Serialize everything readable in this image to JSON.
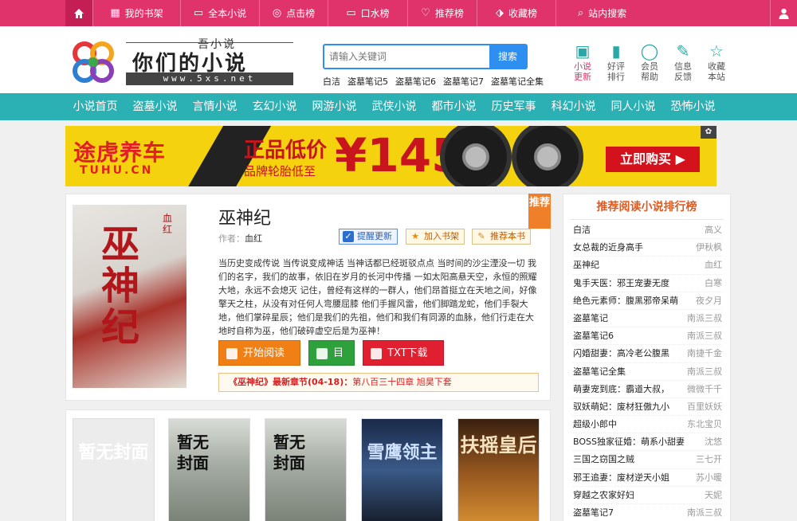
{
  "topbar": {
    "items": [
      {
        "label": "我的书架",
        "icon": "grid-icon",
        "w": 110
      },
      {
        "label": "全本小说",
        "icon": "book-icon",
        "w": 99
      },
      {
        "label": "点击榜",
        "icon": "target-icon",
        "w": 86
      },
      {
        "label": "口水榜",
        "icon": "monitor-icon",
        "w": 100
      },
      {
        "label": "推荐榜",
        "icon": "heart-icon",
        "w": 87
      },
      {
        "label": "收藏榜",
        "icon": "bookmark-icon",
        "w": 99
      },
      {
        "label": "站内搜索",
        "icon": "search-icon",
        "w": 116
      }
    ],
    "colors": {
      "bar": "#e0336b",
      "home": "#c41f55"
    }
  },
  "logo": {
    "subtitle": "吾小说",
    "name": "你们的小说",
    "url": "www.5xs.net"
  },
  "search": {
    "placeholder": "请输入关键词",
    "button": "搜索",
    "hotwords": [
      "白洁",
      "盗墓笔记5",
      "盗墓笔记6",
      "盗墓笔记7",
      "盗墓笔记全集"
    ]
  },
  "header_icons": [
    {
      "label1": "小说",
      "label2": "更新",
      "icon": "new-badge-icon",
      "active": true
    },
    {
      "label1": "好评",
      "label2": "排行",
      "icon": "bar-chart-icon",
      "active": false
    },
    {
      "label1": "会员",
      "label2": "帮助",
      "icon": "lightbulb-icon",
      "active": false
    },
    {
      "label1": "信息",
      "label2": "反馈",
      "icon": "pencil-icon",
      "active": false
    },
    {
      "label1": "收藏",
      "label2": "本站",
      "icon": "star-icon",
      "active": false
    }
  ],
  "nav": {
    "items": [
      "小说首页",
      "盗墓小说",
      "言情小说",
      "玄幻小说",
      "网游小说",
      "武侠小说",
      "都市小说",
      "历史军事",
      "科幻小说",
      "同人小说",
      "恐怖小说"
    ],
    "color": "#2bb0b4"
  },
  "banner": {
    "brand": "途虎养车",
    "brand_sub": "TUHU.CN",
    "headline": "正品低价",
    "sub": "品牌轮胎低至",
    "price": "¥145",
    "cta": "立即购买 ▶"
  },
  "book": {
    "title": "巫神纪",
    "author_label": "作者：",
    "author": "血红",
    "cover_title": "巫神纪",
    "cover_author": "血红",
    "ribbon": "推荐",
    "actions": {
      "remind": "提醒更新",
      "shelf": "加入书架",
      "recommend": "推荐本书"
    },
    "description": "当历史变成传说 当传说变成神话 当神话都已经斑驳点点 当时间的沙尘湮没一切 我们的名字，我们的故事，依旧在岁月的长河中传播 一如太阳高悬天空，永恒的照耀大地，永远不会熄灭 记住，曾经有这样的一群人，他们昂首挺立在天地之间，好像擎天之柱，从没有对任何人弯腰屈膝 他们手握风雷，他们脚踏龙蛇，他们手裂大地，他们掌碎星辰；他们是我们的先祖，他们和我们有同源的血脉，他们行走在大地时自称为巫，他们破碎虚空后是为巫神！",
    "buttons": {
      "read": "开始阅读",
      "toc": "目录",
      "download": "TXT下载"
    },
    "latest_title": "《巫神纪》最新章节(04-18)：",
    "latest_chapter": "第八百三十四章 旭昊下套"
  },
  "covers": [
    {
      "title": "暂无封面",
      "style": "blank"
    },
    {
      "title": "暂无封面",
      "style": "scene"
    },
    {
      "title": "暂无封面",
      "style": "scene"
    },
    {
      "title": "雪鹰领主",
      "style": "dark"
    },
    {
      "title": "扶摇皇后",
      "style": "gold"
    }
  ],
  "rank": {
    "title": "推荐阅读小说排行榜",
    "rows": [
      {
        "name": "白洁",
        "author": "高义"
      },
      {
        "name": "女总裁的近身高手",
        "author": "伊秋枫"
      },
      {
        "name": "巫神纪",
        "author": "血红"
      },
      {
        "name": "鬼手天医：邪王宠妻无度",
        "author": "白寒"
      },
      {
        "name": "绝色元素师：腹黑邪帝呆萌",
        "author": "夜夕月"
      },
      {
        "name": "盗墓笔记",
        "author": "南派三叔"
      },
      {
        "name": "盗墓笔记6",
        "author": "南派三叔"
      },
      {
        "name": "闪婚甜妻：高冷老公腹黑",
        "author": "南捷千金"
      },
      {
        "name": "盗墓笔记全集",
        "author": "南派三叔"
      },
      {
        "name": "萌妻宠到底：霸道大叔，",
        "author": "微微千千"
      },
      {
        "name": "驭妖萌妃：废材狂傲九小",
        "author": "百里妖妖"
      },
      {
        "name": "超级小郎中",
        "author": "东北宝贝"
      },
      {
        "name": "BOSS独家征婚：萌系小甜妻",
        "author": "沈悠"
      },
      {
        "name": "三国之窃国之贼",
        "author": "三七开"
      },
      {
        "name": "邪王追妻：废材逆天小姐",
        "author": "苏小暖"
      },
      {
        "name": "穿越之农家好妇",
        "author": "天妮"
      },
      {
        "name": "盗墓笔记7",
        "author": "南派三叔"
      }
    ]
  }
}
